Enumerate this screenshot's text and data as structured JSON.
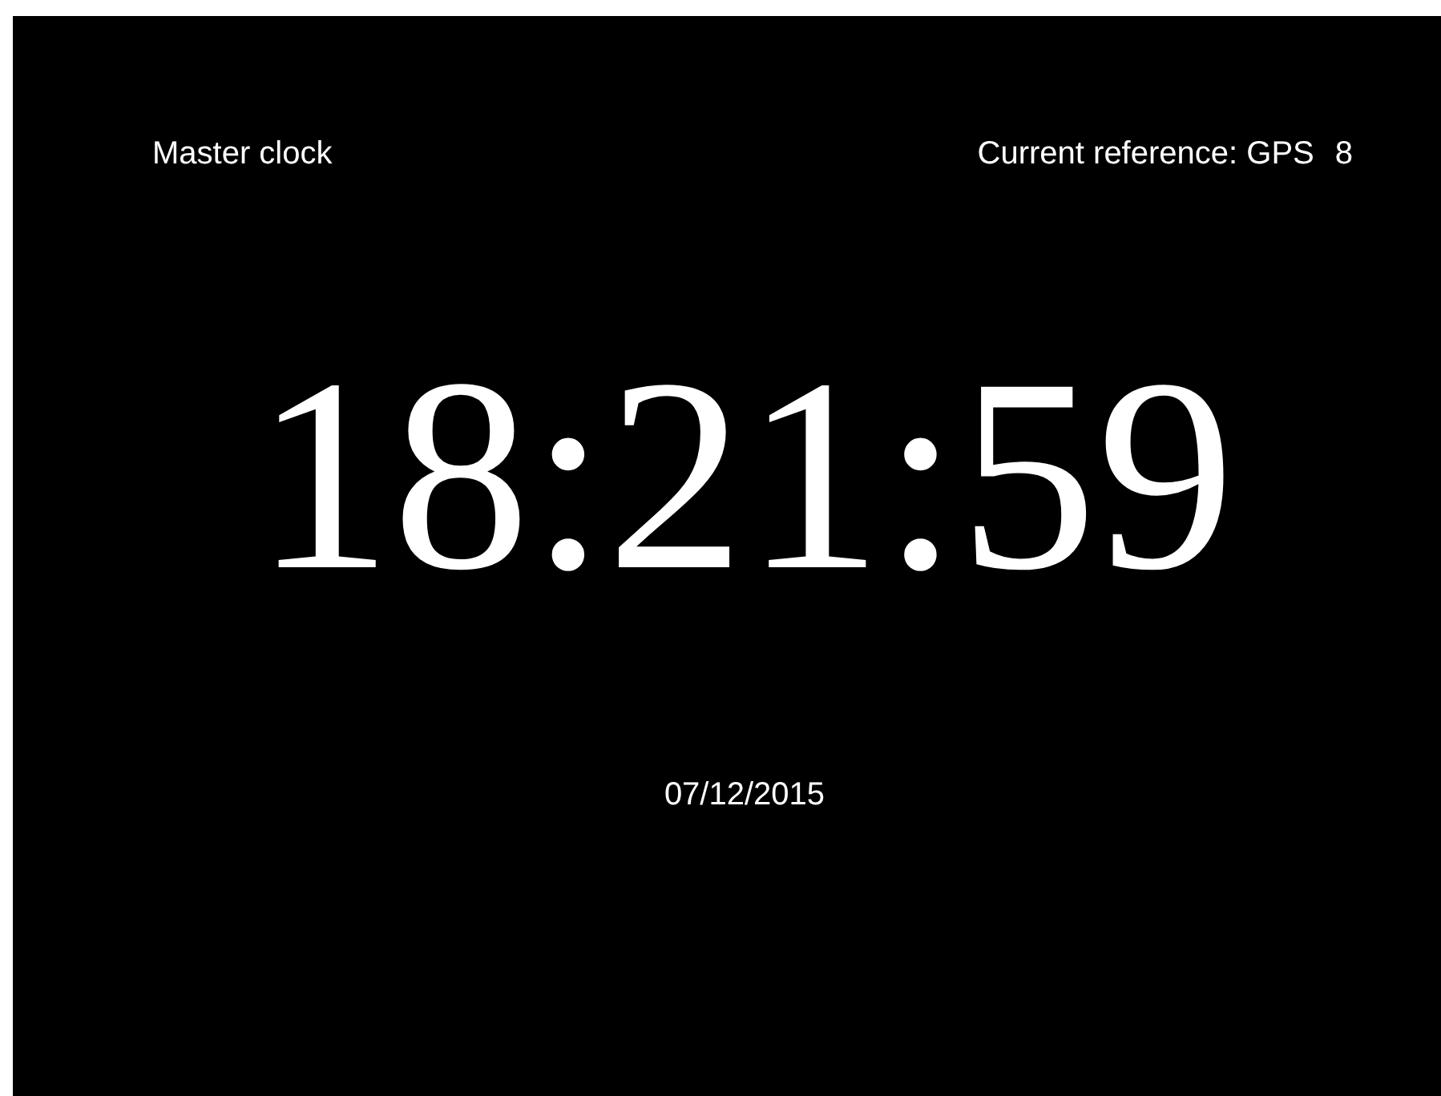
{
  "header": {
    "title": "Master clock",
    "reference": "Current reference: GPS",
    "satellites": "8"
  },
  "time": "18:21:59",
  "date": "07/12/2015"
}
